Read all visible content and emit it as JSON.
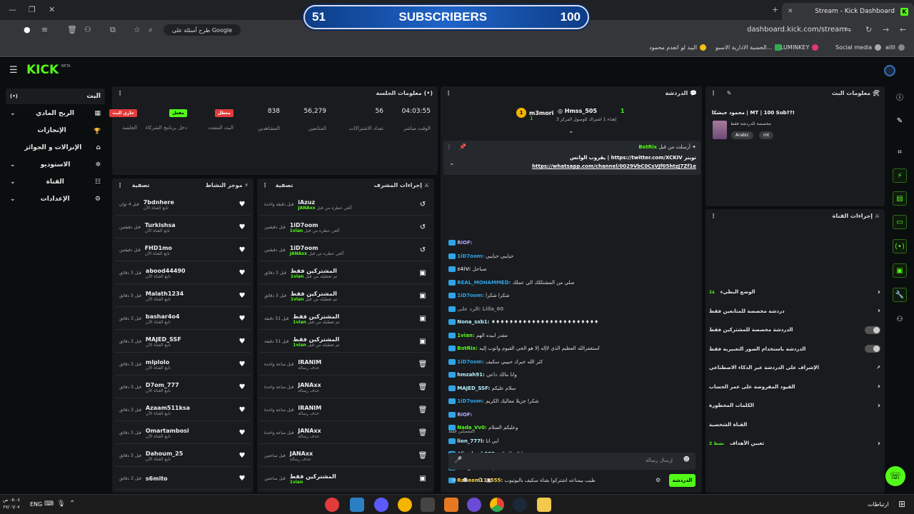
{
  "browser": {
    "tab_title": "Stream - Kick Dashboard",
    "url": "dashboard.kick.com/stream",
    "google_search_label": "طرح أسئلة على Google",
    "bookmarks": [
      "Social media",
      "LUMINKEY",
      "الحسبة الادارية الاسبو...",
      "البيد لو انعدم محمود",
      "allll"
    ]
  },
  "overlay": {
    "left": "51",
    "center": "SUBSCRIBERS",
    "right": "100"
  },
  "brand": {
    "logo": "KICK",
    "beta": "BETA"
  },
  "sidebar": {
    "items": [
      {
        "label": "البث",
        "icon": "(•)"
      },
      {
        "label": "الربح المادي",
        "icon": "▦"
      },
      {
        "label": "الإنجازات",
        "icon": "🏆"
      },
      {
        "label": "الإنزالات و الجوائز",
        "icon": "⌂"
      },
      {
        "label": "الاستوديو",
        "icon": "✲"
      },
      {
        "label": "القناة",
        "icon": "☷"
      },
      {
        "label": "الإعدادات",
        "icon": "⚙"
      }
    ]
  },
  "session": {
    "title": "معلومات الجلسة",
    "stats": [
      {
        "value": "04:03:55",
        "label": "الوقت مباشر"
      },
      {
        "value": "56",
        "label": "تعداد الاشتراكات"
      },
      {
        "value": "56,279",
        "label": "المتابعين"
      },
      {
        "value": "838",
        "label": "المشاهدين"
      },
      {
        "badge": "معطل",
        "label": "البث المتعدد",
        "color": "#e23b3b"
      },
      {
        "badge": "مفعل",
        "label": "دخل برنامج الشركاء",
        "color": "#53fc18"
      },
      {
        "badge": "جاري البث",
        "label": "الجلسة",
        "color": "#e23b3b"
      }
    ]
  },
  "activity": {
    "title": "موجز النشاط",
    "filter": "تصفية",
    "items": [
      {
        "user": "7bdnhere",
        "sub": "تابع القناة الآن",
        "time": "قبل 4 ثوان"
      },
      {
        "user": "Turkishsa",
        "sub": "تابع القناة الآن",
        "time": "قبل دقيقتين"
      },
      {
        "user": "FHD1mo",
        "sub": "تابع القناة الآن",
        "time": "قبل دقيقتين"
      },
      {
        "user": "abood44490",
        "sub": "تابع القناة الآن",
        "time": "قبل 3 دقائق"
      },
      {
        "user": "Malath1234",
        "sub": "تابع القناة الآن",
        "time": "قبل 3 دقائق"
      },
      {
        "user": "bashar4o4",
        "sub": "تابع القناة الآن",
        "time": "قبل 3 دقائق"
      },
      {
        "user": "MAJED_SSF",
        "sub": "تابع القناة الآن",
        "time": "قبل 3 دقائق"
      },
      {
        "user": "mlplolo",
        "sub": "تابع القناة الآن",
        "time": "قبل 3 دقائق"
      },
      {
        "user": "D7om_777",
        "sub": "تابع القناة الآن",
        "time": "قبل 3 دقائق"
      },
      {
        "user": "Azaam511ksa",
        "sub": "تابع القناة الآن",
        "time": "قبل 3 دقائق"
      },
      {
        "user": "Omartambosi",
        "sub": "تابع القناة الآن",
        "time": "قبل 3 دقائق"
      },
      {
        "user": "Dahoum_25",
        "sub": "تابع القناة الآن",
        "time": "قبل 3 دقائق"
      },
      {
        "user": "s6mito",
        "sub": "",
        "time": "قبل 3 دقائق"
      }
    ]
  },
  "modactions": {
    "title": "إجراءات المشرف",
    "filter": "تصفية",
    "items": [
      {
        "title": "iAzuz",
        "sub": "ألغي حظره من قبل",
        "by": "JANAxx",
        "time": "قبل دقيقة واحدة",
        "icon": "↺"
      },
      {
        "title": "1iD7oom",
        "sub": "ألغي حظره من قبل",
        "by": "1vian",
        "time": "قبل دقيقتين",
        "icon": "↺"
      },
      {
        "title": "1iD7oom",
        "sub": "ألغي حظره من قبل",
        "by": "JANAxx",
        "time": "قبل دقيقتين",
        "icon": "↺"
      },
      {
        "title": "المشتركين فقط",
        "sub": "تم تعطيله من قبل",
        "by": "1vian",
        "time": "قبل 3 دقائق",
        "icon": "▣"
      },
      {
        "title": "المشتركين فقط",
        "sub": "تم تعطيله من قبل",
        "by": "1vian",
        "time": "قبل 3 دقائق",
        "icon": "▣"
      },
      {
        "title": "المشتركين فقط",
        "sub": "تم تعطيله من قبل",
        "by": "1vian",
        "time": "قبل 51 دقيقة",
        "icon": "▣"
      },
      {
        "title": "المشتركين فقط",
        "sub": "تم تعطيله من قبل",
        "by": "1vian",
        "time": "قبل 51 دقيقة",
        "icon": "▣"
      },
      {
        "title": "IRANIM",
        "sub": "حذف رسالة",
        "by": "",
        "time": "قبل ساعة واحدة",
        "icon": "🗑"
      },
      {
        "title": "JANAxx",
        "sub": "حذف رسالة",
        "by": "",
        "time": "قبل ساعة واحدة",
        "icon": "🗑"
      },
      {
        "title": "IRANIM",
        "sub": "حذف رسالة",
        "by": "",
        "time": "قبل ساعة واحدة",
        "icon": "🗑"
      },
      {
        "title": "JANAxx",
        "sub": "حذف رسالة",
        "by": "",
        "time": "قبل ساعة واحدة",
        "icon": "🗑"
      },
      {
        "title": "JANAxx",
        "sub": "حذف رسالة",
        "by": "",
        "time": "قبل ساعتين",
        "icon": "🗑"
      },
      {
        "title": "المشتركين فقط",
        "sub": "",
        "by": "1vian",
        "time": "قبل ساعتين",
        "icon": "▣"
      }
    ]
  },
  "chat": {
    "title": "الدردشة",
    "top_gifters": [
      {
        "name": "m3mori",
        "count": "1"
      },
      {
        "name": "Hmss_505",
        "count": "1",
        "note": "إهداء 1 اشتراك للوصول المركز 3"
      }
    ],
    "pinned": {
      "header": "أرسلت من قبل",
      "user": "BotRix",
      "line1": "يقروب الواتس | https://twitter.com/XCKIV تويتر",
      "line2": "https://whatsapp.com/channel/0029VbC0CsVJf05htzJ7Zf1e"
    },
    "messages": [
      {
        "user": "RiOF:",
        "text": "",
        "color": "#b0b0ff"
      },
      {
        "user": "1iD7oom:",
        "text": "حبايبي حبايبي",
        "color": "#2fa4e7"
      },
      {
        "user": "z4iV:",
        "text": "صباحل",
        "color": "#b9b9b9"
      },
      {
        "user": "REAL_MOHAMMED:",
        "text": "صلي من المشتكلك الي عملك",
        "color": "#2fa4e7"
      },
      {
        "user": "1iD7oom:",
        "text": "شكرا شكرا",
        "color": "#2fa4e7"
      },
      {
        "user": "الرد على: Lilla_60",
        "text": "",
        "color": "#888"
      },
      {
        "user": "Nona_sxb1:",
        "text": "♦♦♦♦♦♦♦♦♦♦♦♦♦♦♦♦♦♦♦♦♦♦♦♦",
        "color": "#b9f2ff"
      },
      {
        "user": "1vian:",
        "text": "مقدر ابيده الهم",
        "color": "#53fc18"
      },
      {
        "user": "BotRix:",
        "text": "أستغفرالله العظيم الذي لاإله إلا هو الحي القيوم وأتوب إليه",
        "color": "#53fc18"
      },
      {
        "user": "1iD7oom:",
        "text": "كثر الله خيرك حبيبي سكيف",
        "color": "#2fa4e7"
      },
      {
        "user": "hmzah91:",
        "text": "وانا مالك داعي",
        "color": "#b9f2ff"
      },
      {
        "user": "MAJED_SSF:",
        "text": "سلام عليكم",
        "color": "#b9f2ff"
      },
      {
        "user": "1iD7oom:",
        "text": "شكرا جزيلا معاليك الكريم",
        "color": "#2fa4e7"
      },
      {
        "user": "RiOF:",
        "text": "",
        "color": "#b0b0ff"
      },
      {
        "user": "Nada_Vv0:",
        "text": "وعليكم السلام",
        "color": "#53fc18"
      },
      {
        "user": "lion_777l:",
        "text": "أبي انا",
        "color": "#b9f2ff"
      },
      {
        "user": "Aljouhrah555:",
        "text": "وعليكم السلام",
        "color": "#b9f2ff"
      },
      {
        "user": "lion_777l:",
        "text": "أبي انا",
        "color": "#b9f2ff"
      },
      {
        "user": "Raneem111555:",
        "text": "طيب بيمناعه اشتركوا بقناة سكيف باليوتيوب",
        "color": "#ffd54a"
      }
    ],
    "emote_label": "المفضلين فقط",
    "input_placeholder": "إرسال رسالة",
    "send_label": "الدردشة",
    "points": "0"
  },
  "streaminfo": {
    "title": "معلومات البث",
    "stream_title": "محمود حبشكا | MT | 100 Sub??!",
    "category": "مخصصة للدردشة فقط",
    "tags": [
      "Arabic",
      "mt"
    ]
  },
  "channelactions": {
    "title": "إجراءات القناة",
    "items": [
      {
        "label": "الوضع البطيء",
        "control": "chevron",
        "extra": "1s"
      },
      {
        "label": "دردشة مخصصة للمتابعين فقط",
        "control": "chevron"
      },
      {
        "label": "الدردشة مخصصة للمشتركين فقط",
        "control": "toggle"
      },
      {
        "label": "الدردشة باستخدام الصور التعبيرية فقط",
        "control": "toggle"
      },
      {
        "label": "الإشراف على الدردشة عبر الذكاء الاصطناعي",
        "control": "external"
      },
      {
        "label": "القيود المفروضة على عمر الحساب",
        "control": "chevron"
      },
      {
        "label": "الكلمات المحظورة",
        "control": "chevron"
      },
      {
        "label": "القناة الشخصية",
        "control": "none"
      },
      {
        "label": "تعيين الأهداف",
        "control": "chevron",
        "extra": "نشط 2"
      }
    ]
  },
  "taskbar": {
    "time": "٠٥:٠٤ ص",
    "date": "٢٧/٠٦/٠٧",
    "lang": "ENG",
    "tray_text": "ارتباطات"
  }
}
